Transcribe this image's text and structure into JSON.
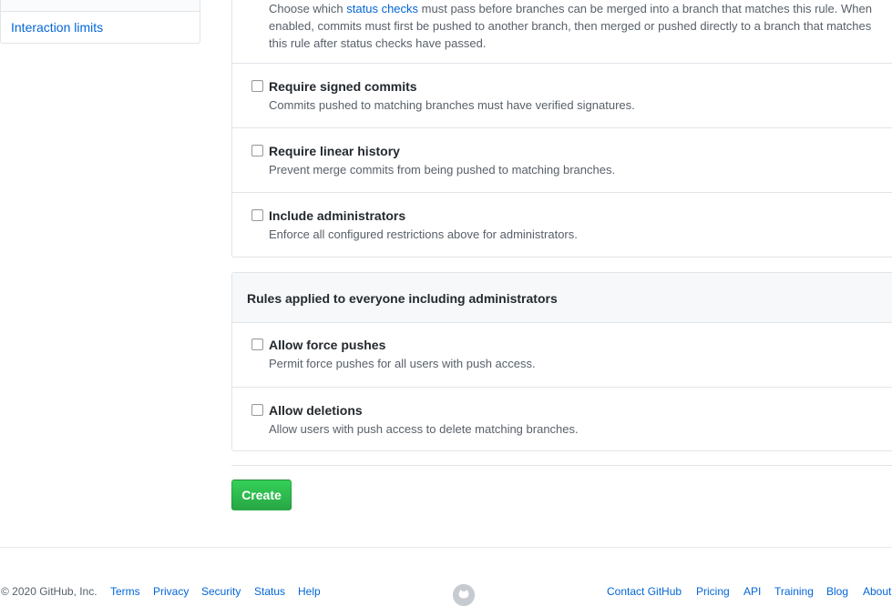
{
  "sidebar": {
    "items": [
      {
        "label": "Interaction limits"
      }
    ]
  },
  "status_checks": {
    "text_before": "Choose which ",
    "link": "status checks",
    "text_after": " must pass before branches can be merged into a branch that matches this rule. When enabled, commits must first be pushed to another branch, then merged or pushed directly to a branch that matches this rule after status checks have passed."
  },
  "rules": [
    {
      "title": "Require signed commits",
      "description": "Commits pushed to matching branches must have verified signatures.",
      "checked": false
    },
    {
      "title": "Require linear history",
      "description": "Prevent merge commits from being pushed to matching branches.",
      "checked": false
    },
    {
      "title": "Include administrators",
      "description": "Enforce all configured restrictions above for administrators.",
      "checked": false
    }
  ],
  "everyone_section": {
    "title": "Rules applied to everyone including administrators",
    "rules": [
      {
        "title": "Allow force pushes",
        "description": "Permit force pushes for all users with push access.",
        "checked": false
      },
      {
        "title": "Allow deletions",
        "description": "Allow users with push access to delete matching branches.",
        "checked": false
      }
    ]
  },
  "create_button": {
    "label": "Create",
    "color": "#2ea44f"
  },
  "footer": {
    "copyright": "© 2020 GitHub, Inc.",
    "left_links": [
      "Terms",
      "Privacy",
      "Security",
      "Status",
      "Help"
    ],
    "right_links": [
      "Contact GitHub",
      "Pricing",
      "API",
      "Training",
      "Blog",
      "About"
    ],
    "logo_icon": "github-mark-icon"
  }
}
